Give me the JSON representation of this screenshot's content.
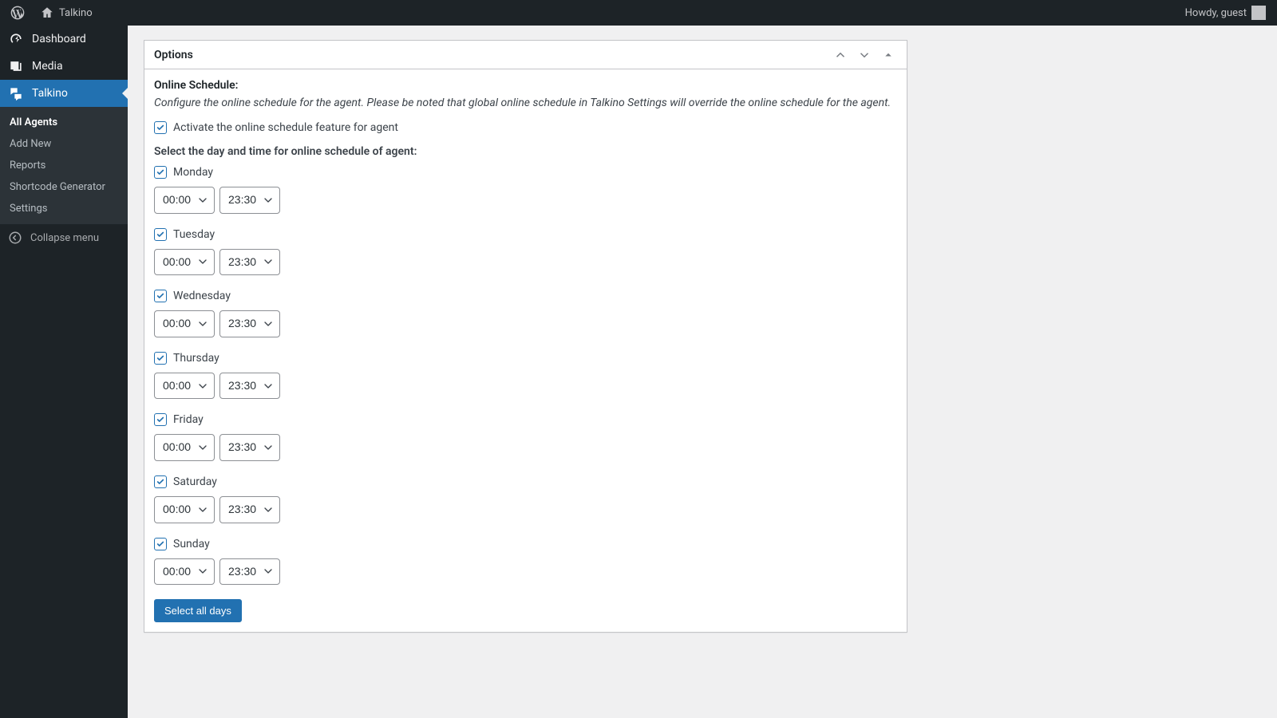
{
  "adminbar": {
    "site_title": "Talkino",
    "howdy": "Howdy, guest"
  },
  "sidebar": {
    "items": [
      {
        "label": "Dashboard"
      },
      {
        "label": "Media"
      },
      {
        "label": "Talkino"
      }
    ],
    "talkino_submenu": [
      {
        "label": "All Agents"
      },
      {
        "label": "Add New"
      },
      {
        "label": "Reports"
      },
      {
        "label": "Shortcode Generator"
      },
      {
        "label": "Settings"
      }
    ],
    "collapse_label": "Collapse menu"
  },
  "postbox": {
    "title": "Options",
    "section_title": "Online Schedule:",
    "description": "Configure the online schedule for the agent. Please be noted that global online schedule in Talkino Settings will override the online schedule for the agent.",
    "activate_label": "Activate the online schedule feature for agent",
    "schedule_heading": "Select the day and time for online schedule of agent:",
    "days": [
      {
        "label": "Monday",
        "start": "00:00",
        "end": "23:30"
      },
      {
        "label": "Tuesday",
        "start": "00:00",
        "end": "23:30"
      },
      {
        "label": "Wednesday",
        "start": "00:00",
        "end": "23:30"
      },
      {
        "label": "Thursday",
        "start": "00:00",
        "end": "23:30"
      },
      {
        "label": "Friday",
        "start": "00:00",
        "end": "23:30"
      },
      {
        "label": "Saturday",
        "start": "00:00",
        "end": "23:30"
      },
      {
        "label": "Sunday",
        "start": "00:00",
        "end": "23:30"
      }
    ],
    "select_all_button": "Select all days"
  }
}
